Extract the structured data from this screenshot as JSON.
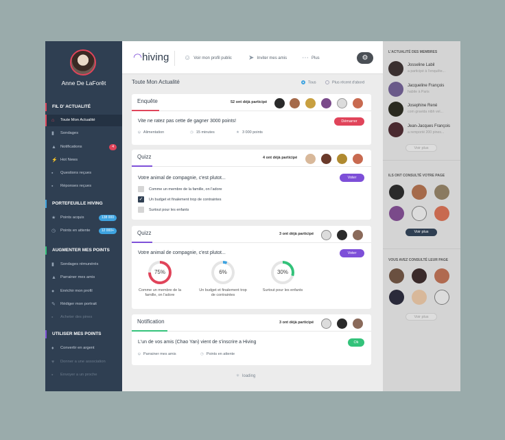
{
  "user": {
    "name": "Anne De LaForêt"
  },
  "sidebar": {
    "sections": [
      {
        "label": "FIL D' ACTUALITÉ",
        "color": "#e0445a"
      },
      {
        "label": "PORTEFEUILLE HIVING",
        "color": "#3ea3e0"
      },
      {
        "label": "AUGMENTER MES POINTS",
        "color": "#33c27a"
      },
      {
        "label": "UTILISER MES POINTS",
        "color": "#7d4fd8"
      }
    ],
    "items": [
      {
        "label": "Toute Mon Actualité",
        "icon": "home-icon"
      },
      {
        "label": "Sondages",
        "icon": "bar-chart-icon"
      },
      {
        "label": "Notifications",
        "icon": "bell-icon",
        "badge": "4"
      },
      {
        "label": "Hot News",
        "icon": "lightning-icon"
      },
      {
        "label": "Questions reçues",
        "icon": "chat-icon"
      },
      {
        "label": "Réponses reçues",
        "icon": "chat-reply-icon"
      },
      {
        "label": "Points acquis",
        "icon": "star-icon",
        "badge": "138 000"
      },
      {
        "label": "Points en attente",
        "icon": "clock-icon",
        "badge": "12 000+"
      },
      {
        "label": "Sondages rémunérés",
        "icon": "bar-chart-icon"
      },
      {
        "label": "Parrainer mes amis",
        "icon": "thumbs-up-icon"
      },
      {
        "label": "Enrichir mon profil",
        "icon": "user-icon"
      },
      {
        "label": "Rédiger mon portrait",
        "icon": "pencil-icon"
      },
      {
        "label": "Acheter des pines",
        "icon": "cart-icon"
      },
      {
        "label": "Convertir en argent",
        "icon": "money-icon"
      },
      {
        "label": "Donner a une association",
        "icon": "heart-icon"
      },
      {
        "label": "Envoyer a un proche",
        "icon": "gift-icon"
      }
    ]
  },
  "topbar": {
    "logo": "hiving",
    "links": [
      "Voir mon profil public",
      "Inviter mes amis",
      "Plus"
    ]
  },
  "feed": {
    "title": "Toute Mon Actualité",
    "filters": [
      "Tous",
      "Plus récent d'abord"
    ]
  },
  "cards": [
    {
      "title": "Enquête",
      "participants": "52 ont déjà participé",
      "question": "Vite ne ratez pas cette de gagner 3000 points!",
      "button": "Démarrer",
      "meta": [
        "Alimentation",
        "15 minutes",
        "3 000 points"
      ]
    },
    {
      "title": "Quizz",
      "participants": "4 ont déjà participé",
      "question": "Votre animal de compagnie, c'est plutot...",
      "button": "Voter",
      "options": [
        {
          "label": "Comme un membre de la famille, on l'adore",
          "checked": false
        },
        {
          "label": "Un budget et finalement trop de contraintes",
          "checked": true
        },
        {
          "label": "Surtout pour les enfants",
          "checked": false
        }
      ]
    },
    {
      "title": "Quizz",
      "participants": "3 ont déjà participé",
      "question": "Votre animal de compagnie, c'est plutot...",
      "button": "Voter",
      "results": [
        {
          "value": 75,
          "label": "75%",
          "caption": "Comme un membre de la famille, on l'adore",
          "color": "#e0445a"
        },
        {
          "value": 6,
          "label": "6%",
          "caption": "Un budget et finalement trop de contraintes",
          "color": "#3ea3e0"
        },
        {
          "value": 30,
          "label": "30%",
          "caption": "Surtout pour les enfants",
          "color": "#33c27a"
        }
      ]
    },
    {
      "title": "Notification",
      "participants": "3 ont déjà participé",
      "question": "L'un de vos amis (Chao Yan) vient de s'inscrire a Hiving",
      "button": "Ok",
      "meta": [
        "Parrainer mes amis",
        "Points en attente"
      ]
    }
  ],
  "loading": "loading",
  "right": {
    "members_title": "L'ACTUALITÉ DES MEMBRES",
    "members": [
      {
        "name": "Josseline Labil",
        "desc": "a participé à l'enquête..."
      },
      {
        "name": "Jacqueline François",
        "desc": "habite à Paris"
      },
      {
        "name": "Josephine René",
        "desc": "com gravida nibh vel..."
      },
      {
        "name": "Jean-Jacques François",
        "desc": "a remporté 200 pines..."
      }
    ],
    "see_more": "Voir plus",
    "visited_title": "ILS ONT CONSULTÉ VOTRE PAGE",
    "visited_more": "Voir plus",
    "consulted_title": "VOUS AVEZ CONSULTÉ LEUR PAGE",
    "consulted_more": "Voir plus"
  }
}
